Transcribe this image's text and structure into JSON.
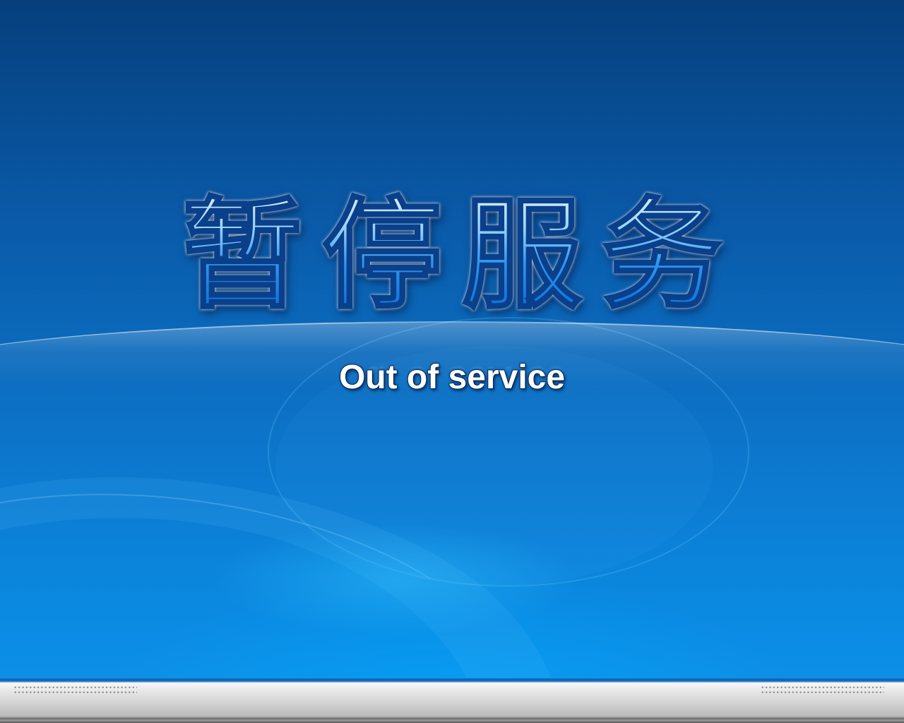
{
  "screen": {
    "title_cn": "暂停服务",
    "subtitle_en": "Out of service"
  },
  "colors": {
    "background_top": "#053f7c",
    "background_bottom": "#0f93ea",
    "title_fill": "#2f96ef",
    "title_outline": "#0a3f8a",
    "subtitle_fill": "#ffffff",
    "bottom_bar": "#cfcfcf"
  },
  "decorations": {
    "bottom_bar_icon": "speaker-grille-icon"
  }
}
